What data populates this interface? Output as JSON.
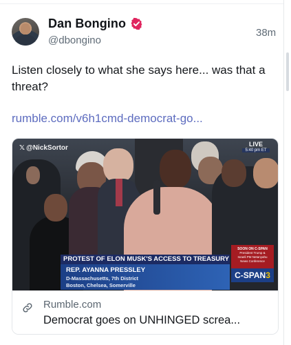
{
  "post": {
    "author_name": "Dan Bongino",
    "author_handle": "@dbongino",
    "timestamp": "38m",
    "text": "Listen closely to what she says here... was that a threat?",
    "link_text": "rumble.com/v6h1cmd-democrat-go..."
  },
  "icons": {
    "verified": "verified-badge-icon",
    "link": "link-chain-icon",
    "x_logo": "x-logo-icon"
  },
  "colors": {
    "verified_badge": "#e0245e",
    "link": "#5d6cbf",
    "secondary_text": "#5f6b76"
  },
  "media": {
    "watermark": "@NickSortor",
    "live_label": "LIVE",
    "live_time": "5:40 pm ET",
    "banner_headline": "PROTEST OF ELON MUSK'S ACCESS TO TREASURY DEPT.",
    "banner_name": "REP. AYANNA PRESSLEY",
    "banner_district": "D-Massachusetts, 7th District",
    "banner_cities": "Boston, Chelsea, Somerville",
    "soon_title": "SOON ON C-SPAN",
    "soon_line1": "President Trump &",
    "soon_line2": "Israeli PM Netanyahu",
    "soon_line3": "News Conference",
    "network_prefix": "C-SPAN",
    "network_number": "3"
  },
  "card": {
    "domain": "Rumble.com",
    "title": "Democrat goes on UNHINGED screa..."
  }
}
